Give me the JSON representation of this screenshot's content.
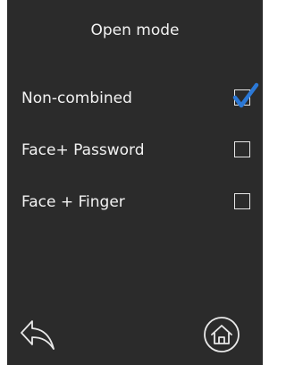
{
  "title": "Open mode",
  "options": [
    {
      "label": "Non-combined",
      "checked": true
    },
    {
      "label": "Face+ Password",
      "checked": false
    },
    {
      "label": "Face + Finger",
      "checked": false
    }
  ],
  "colors": {
    "background": "#2b2b2b",
    "text": "#f2f2f2",
    "check_accent": "#2b78d6"
  },
  "icons": {
    "back": "back-arrow-icon",
    "home": "home-icon"
  }
}
